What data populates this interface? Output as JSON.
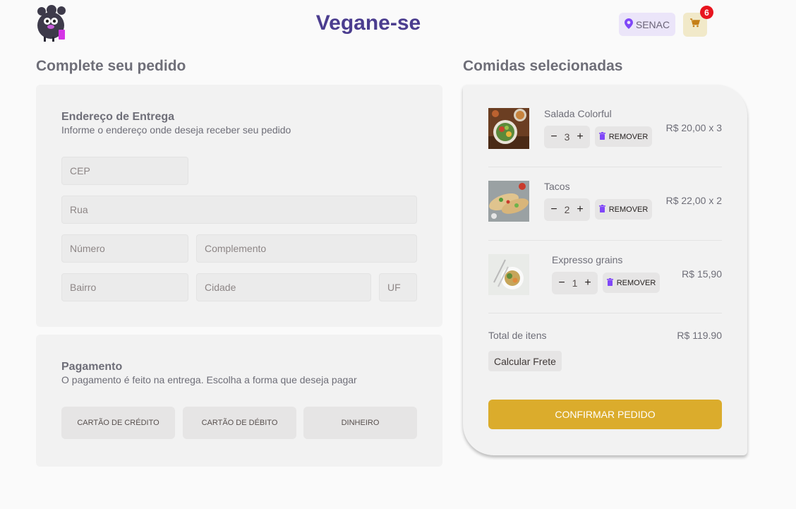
{
  "header": {
    "title": "Vegane-se",
    "location": "SENAC",
    "cart_count": "6",
    "icons": {
      "logo": "mascot-logo",
      "location": "map-pin-icon",
      "cart": "shopping-cart-icon"
    }
  },
  "checkout": {
    "title": "Complete seu pedido",
    "address": {
      "heading": "Endereço de Entrega",
      "subtitle": "Informe o endereço onde deseja receber seu pedido",
      "fields": {
        "cep": {
          "placeholder": "CEP",
          "value": ""
        },
        "street": {
          "placeholder": "Rua",
          "value": ""
        },
        "number": {
          "placeholder": "Número",
          "value": ""
        },
        "complement": {
          "placeholder": "Complemento",
          "value": ""
        },
        "district": {
          "placeholder": "Bairro",
          "value": ""
        },
        "city": {
          "placeholder": "Cidade",
          "value": ""
        },
        "state": {
          "placeholder": "UF",
          "value": ""
        }
      }
    },
    "payment": {
      "heading": "Pagamento",
      "subtitle": "O pagamento é feito na entrega. Escolha a forma que deseja pagar",
      "options": [
        "Cartão de Crédito",
        "Cartão de Débito",
        "Dinheiro"
      ]
    }
  },
  "cart": {
    "title": "Comidas selecionadas",
    "remove_label": "REMOVER",
    "items": [
      {
        "name": "Salada Colorful",
        "quantity": "3",
        "price": "R$ 20,00 x 3"
      },
      {
        "name": "Tacos",
        "quantity": "2",
        "price": "R$ 22,00 x 2"
      },
      {
        "name": "Expresso grains",
        "quantity": "1",
        "price": "R$ 15,90"
      }
    ],
    "total_label": "Total de itens",
    "total_value": "R$ 119.90",
    "freight_label": "Calcular Frete",
    "confirm_label": "Confirmar Pedido"
  },
  "colors": {
    "brand": "#4b3d8f",
    "accent_purple": "#8047f8",
    "confirm_yellow": "#dbac2c",
    "badge_red": "#e8141e"
  }
}
